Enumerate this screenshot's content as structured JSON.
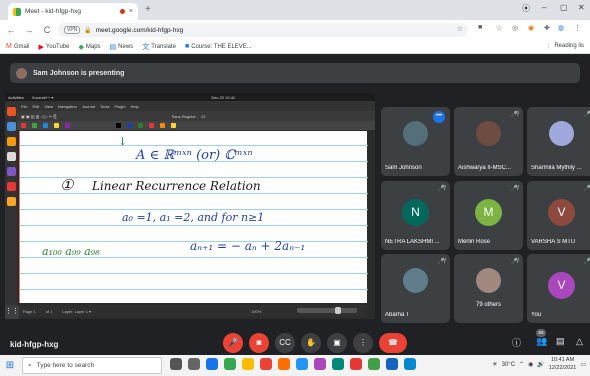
{
  "browser": {
    "tab_title": "Meet - kid-hfgp-hxg",
    "tab_close": "×",
    "new_tab": "+",
    "window_controls": [
      "⦿",
      "–",
      "▢",
      "✕"
    ],
    "url": "meet.google.com/kid-hfgp-hxg",
    "vpn_label": "VPN",
    "nav": {
      "back": "←",
      "forward": "→",
      "reload": "C"
    },
    "bookmarks": [
      {
        "label": "Gmail",
        "icon": "M",
        "color": "#ea4335"
      },
      {
        "label": "YouTube",
        "icon": "▶",
        "color": "#ff0000"
      },
      {
        "label": "Maps",
        "icon": "◆",
        "color": "#34a853"
      },
      {
        "label": "News",
        "icon": "▤",
        "color": "#1a73e8"
      },
      {
        "label": "Translate",
        "icon": "文",
        "color": "#1a73e8"
      },
      {
        "label": "Course: THE ELEVE...",
        "icon": "■",
        "color": "#1a73e8"
      }
    ],
    "reading_list": "Reading lis"
  },
  "meet": {
    "presenting_text": "Sam Johnson is presenting",
    "meeting_code": "kid-hfgp-hxg",
    "participants_badge": "83",
    "tiles": [
      {
        "name": "Sam Johnson",
        "type": "photo",
        "color": "#546e7a",
        "more": true
      },
      {
        "name": "Aishwarya II-MSC...",
        "type": "photo",
        "color": "#6d4c41"
      },
      {
        "name": "Sharmila Mythily ...",
        "type": "photo",
        "color": "#9fa8da"
      },
      {
        "name": "NETRA LAKSHMI ...",
        "type": "letter",
        "letter": "N",
        "color": "#00695c"
      },
      {
        "name": "Merlin Rose",
        "type": "letter",
        "letter": "M",
        "color": "#7cb342"
      },
      {
        "name": "VARSHA S MTU",
        "type": "letter",
        "letter": "V",
        "color": "#8d4a3c"
      },
      {
        "name": "Abarna T",
        "type": "photo",
        "color": "#607d8b"
      },
      {
        "name": "79 others",
        "type": "others",
        "color": "#a1887f"
      },
      {
        "name": "You",
        "type": "letter",
        "letter": "V",
        "color": "#ab47bc"
      }
    ]
  },
  "shared_screen": {
    "top_bar": [
      "Activities",
      "Xournal++ ▾",
      "Dec 22 10:41"
    ],
    "menu": [
      "File",
      "Edit",
      "View",
      "Navigation",
      "Journal",
      "Tools",
      "Plugin",
      "Help"
    ],
    "toolbar_text": [
      "Sans Regular",
      "12"
    ],
    "notes": {
      "line1": "A ∈ ℝᵐˣⁿ (or) ℂᵐˣⁿ",
      "line2_num": "①",
      "line2_text": "Linear Recurrence Relation",
      "line3": "a₀ =1, a₁ =2,  and   for n≥1",
      "line4_left": "a₁₀₀  a₉₉  a₉₈",
      "line4_right": "aₙ₊₁ = − aₙ + 2aₙ₋₁",
      "arrow": "↓"
    },
    "status": [
      "Page 1",
      "of 1",
      "Layer: Layer 1 ▾",
      "100%"
    ]
  },
  "taskbar": {
    "search_placeholder": "Type here to search",
    "weather": "30°C",
    "time": "10:41 AM",
    "date": "12/22/2021"
  }
}
